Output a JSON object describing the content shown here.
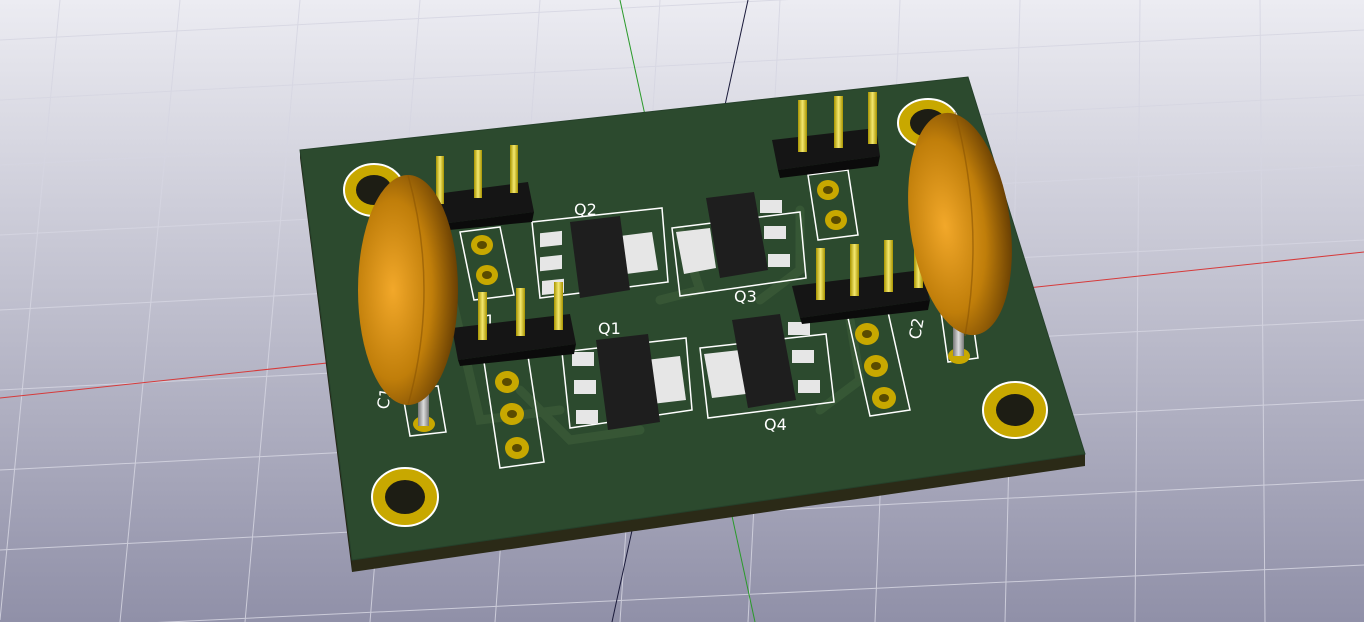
{
  "scene": {
    "background_top": "#e8e8ee",
    "background_bottom": "#8f8fa6",
    "grid_color": "#d4d4e0",
    "axis_x_color": "#d63a3a",
    "axis_y_color": "#2a9a2a",
    "axis_z_color": "#1a1a3a"
  },
  "board": {
    "solder_mask_color": "#2c4a2e",
    "edge_color": "#2b2a17",
    "silkscreen_color": "#ffffff",
    "copper_color": "#c8a800",
    "capacitor_color": "#c07e0a"
  },
  "components": {
    "q1": "Q1",
    "q2": "Q2",
    "q3": "Q3",
    "q4": "Q4",
    "c1": "C1",
    "c2": "C2",
    "j1": "J1"
  }
}
